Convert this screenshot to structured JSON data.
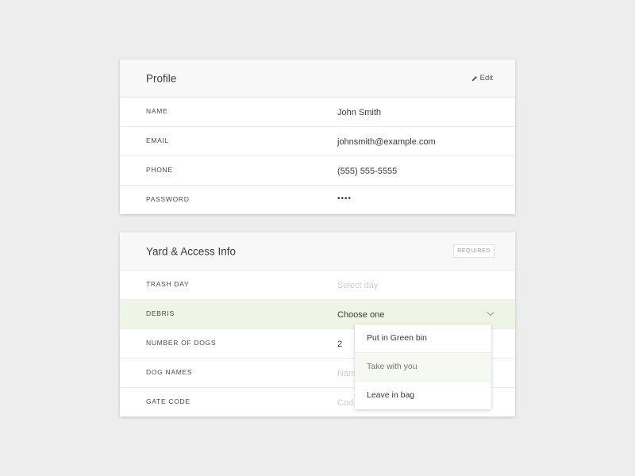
{
  "profile": {
    "title": "Profile",
    "edit_label": "Edit",
    "rows": [
      {
        "label": "NAME",
        "value": "John Smith"
      },
      {
        "label": "EMAIL",
        "value": "johnsmith@example.com"
      },
      {
        "label": "PHONE",
        "value": "(555) 555-5555"
      },
      {
        "label": "PASSWORD",
        "value": "••••"
      }
    ]
  },
  "yard": {
    "title": "Yard & Access Info",
    "required_badge": "REQUIRED",
    "rows": [
      {
        "label": "TRASH DAY",
        "value": "",
        "placeholder": "Select day"
      },
      {
        "label": "DEBRIS",
        "value": "Choose one"
      },
      {
        "label": "NUMBER OF DOGS",
        "value": "2"
      },
      {
        "label": "DOG NAMES",
        "value": "",
        "placeholder": "Nam"
      },
      {
        "label": "GATE CODE",
        "value": "",
        "placeholder": "Cod"
      }
    ]
  },
  "debris_dropdown": {
    "options": [
      "Put in Green bin",
      "Take with you",
      "Leave in bag"
    ],
    "hovered_index": 1
  },
  "colors": {
    "page_bg": "#ededed",
    "header_bg": "#f8f8f8",
    "highlight_bg": "#eef5e4"
  },
  "icons": {
    "edit": "pencil-icon",
    "select": "chevron-down-icon"
  }
}
